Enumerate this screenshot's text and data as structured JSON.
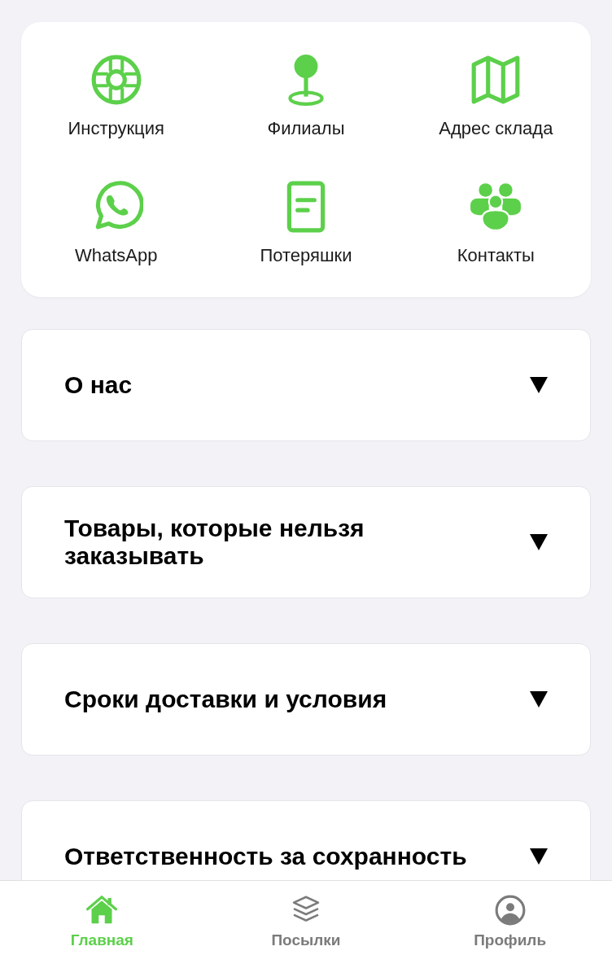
{
  "shortcuts": [
    {
      "label": "Инструкция"
    },
    {
      "label": "Филиалы"
    },
    {
      "label": "Адрес склада"
    },
    {
      "label": "WhatsApp"
    },
    {
      "label": "Потеряшки"
    },
    {
      "label": "Контакты"
    }
  ],
  "sections": [
    {
      "title": "О нас",
      "expanded": false
    },
    {
      "title": "Товары, которые нельзя заказывать",
      "expanded": false
    },
    {
      "title": "Сроки доставки и условия",
      "expanded": false
    },
    {
      "title": "Ответственность за сохранность",
      "expanded": false
    }
  ],
  "bottom_nav": [
    {
      "label": "Главная",
      "selected": true
    },
    {
      "label": "Посылки",
      "selected": false
    },
    {
      "label": "Профиль",
      "selected": false
    }
  ]
}
